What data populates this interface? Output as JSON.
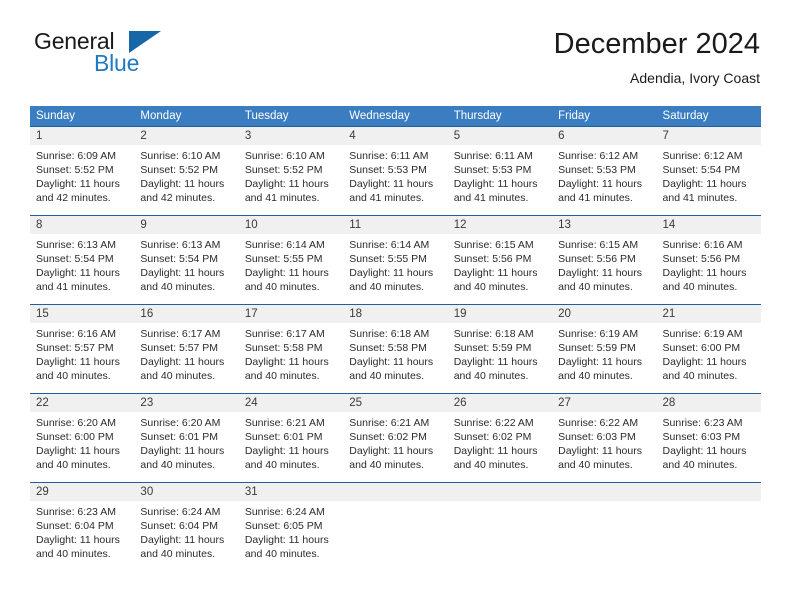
{
  "brand": {
    "name_part1": "General",
    "name_part2": "Blue",
    "triangle_color": "#1667a8",
    "blue_color": "#1f7ac0"
  },
  "header": {
    "title": "December 2024",
    "subtitle": "Adendia, Ivory Coast"
  },
  "theme": {
    "header_row_bg": "#3a7dc0",
    "week_divider": "#1f5fa0",
    "day_number_bg": "#f0f0f0",
    "text_color": "#2b2b2b"
  },
  "weekdays": [
    "Sunday",
    "Monday",
    "Tuesday",
    "Wednesday",
    "Thursday",
    "Friday",
    "Saturday"
  ],
  "weeks": [
    [
      {
        "day": "1",
        "sunrise": "Sunrise: 6:09 AM",
        "sunset": "Sunset: 5:52 PM",
        "daylight1": "Daylight: 11 hours",
        "daylight2": "and 42 minutes."
      },
      {
        "day": "2",
        "sunrise": "Sunrise: 6:10 AM",
        "sunset": "Sunset: 5:52 PM",
        "daylight1": "Daylight: 11 hours",
        "daylight2": "and 42 minutes."
      },
      {
        "day": "3",
        "sunrise": "Sunrise: 6:10 AM",
        "sunset": "Sunset: 5:52 PM",
        "daylight1": "Daylight: 11 hours",
        "daylight2": "and 41 minutes."
      },
      {
        "day": "4",
        "sunrise": "Sunrise: 6:11 AM",
        "sunset": "Sunset: 5:53 PM",
        "daylight1": "Daylight: 11 hours",
        "daylight2": "and 41 minutes."
      },
      {
        "day": "5",
        "sunrise": "Sunrise: 6:11 AM",
        "sunset": "Sunset: 5:53 PM",
        "daylight1": "Daylight: 11 hours",
        "daylight2": "and 41 minutes."
      },
      {
        "day": "6",
        "sunrise": "Sunrise: 6:12 AM",
        "sunset": "Sunset: 5:53 PM",
        "daylight1": "Daylight: 11 hours",
        "daylight2": "and 41 minutes."
      },
      {
        "day": "7",
        "sunrise": "Sunrise: 6:12 AM",
        "sunset": "Sunset: 5:54 PM",
        "daylight1": "Daylight: 11 hours",
        "daylight2": "and 41 minutes."
      }
    ],
    [
      {
        "day": "8",
        "sunrise": "Sunrise: 6:13 AM",
        "sunset": "Sunset: 5:54 PM",
        "daylight1": "Daylight: 11 hours",
        "daylight2": "and 41 minutes."
      },
      {
        "day": "9",
        "sunrise": "Sunrise: 6:13 AM",
        "sunset": "Sunset: 5:54 PM",
        "daylight1": "Daylight: 11 hours",
        "daylight2": "and 40 minutes."
      },
      {
        "day": "10",
        "sunrise": "Sunrise: 6:14 AM",
        "sunset": "Sunset: 5:55 PM",
        "daylight1": "Daylight: 11 hours",
        "daylight2": "and 40 minutes."
      },
      {
        "day": "11",
        "sunrise": "Sunrise: 6:14 AM",
        "sunset": "Sunset: 5:55 PM",
        "daylight1": "Daylight: 11 hours",
        "daylight2": "and 40 minutes."
      },
      {
        "day": "12",
        "sunrise": "Sunrise: 6:15 AM",
        "sunset": "Sunset: 5:56 PM",
        "daylight1": "Daylight: 11 hours",
        "daylight2": "and 40 minutes."
      },
      {
        "day": "13",
        "sunrise": "Sunrise: 6:15 AM",
        "sunset": "Sunset: 5:56 PM",
        "daylight1": "Daylight: 11 hours",
        "daylight2": "and 40 minutes."
      },
      {
        "day": "14",
        "sunrise": "Sunrise: 6:16 AM",
        "sunset": "Sunset: 5:56 PM",
        "daylight1": "Daylight: 11 hours",
        "daylight2": "and 40 minutes."
      }
    ],
    [
      {
        "day": "15",
        "sunrise": "Sunrise: 6:16 AM",
        "sunset": "Sunset: 5:57 PM",
        "daylight1": "Daylight: 11 hours",
        "daylight2": "and 40 minutes."
      },
      {
        "day": "16",
        "sunrise": "Sunrise: 6:17 AM",
        "sunset": "Sunset: 5:57 PM",
        "daylight1": "Daylight: 11 hours",
        "daylight2": "and 40 minutes."
      },
      {
        "day": "17",
        "sunrise": "Sunrise: 6:17 AM",
        "sunset": "Sunset: 5:58 PM",
        "daylight1": "Daylight: 11 hours",
        "daylight2": "and 40 minutes."
      },
      {
        "day": "18",
        "sunrise": "Sunrise: 6:18 AM",
        "sunset": "Sunset: 5:58 PM",
        "daylight1": "Daylight: 11 hours",
        "daylight2": "and 40 minutes."
      },
      {
        "day": "19",
        "sunrise": "Sunrise: 6:18 AM",
        "sunset": "Sunset: 5:59 PM",
        "daylight1": "Daylight: 11 hours",
        "daylight2": "and 40 minutes."
      },
      {
        "day": "20",
        "sunrise": "Sunrise: 6:19 AM",
        "sunset": "Sunset: 5:59 PM",
        "daylight1": "Daylight: 11 hours",
        "daylight2": "and 40 minutes."
      },
      {
        "day": "21",
        "sunrise": "Sunrise: 6:19 AM",
        "sunset": "Sunset: 6:00 PM",
        "daylight1": "Daylight: 11 hours",
        "daylight2": "and 40 minutes."
      }
    ],
    [
      {
        "day": "22",
        "sunrise": "Sunrise: 6:20 AM",
        "sunset": "Sunset: 6:00 PM",
        "daylight1": "Daylight: 11 hours",
        "daylight2": "and 40 minutes."
      },
      {
        "day": "23",
        "sunrise": "Sunrise: 6:20 AM",
        "sunset": "Sunset: 6:01 PM",
        "daylight1": "Daylight: 11 hours",
        "daylight2": "and 40 minutes."
      },
      {
        "day": "24",
        "sunrise": "Sunrise: 6:21 AM",
        "sunset": "Sunset: 6:01 PM",
        "daylight1": "Daylight: 11 hours",
        "daylight2": "and 40 minutes."
      },
      {
        "day": "25",
        "sunrise": "Sunrise: 6:21 AM",
        "sunset": "Sunset: 6:02 PM",
        "daylight1": "Daylight: 11 hours",
        "daylight2": "and 40 minutes."
      },
      {
        "day": "26",
        "sunrise": "Sunrise: 6:22 AM",
        "sunset": "Sunset: 6:02 PM",
        "daylight1": "Daylight: 11 hours",
        "daylight2": "and 40 minutes."
      },
      {
        "day": "27",
        "sunrise": "Sunrise: 6:22 AM",
        "sunset": "Sunset: 6:03 PM",
        "daylight1": "Daylight: 11 hours",
        "daylight2": "and 40 minutes."
      },
      {
        "day": "28",
        "sunrise": "Sunrise: 6:23 AM",
        "sunset": "Sunset: 6:03 PM",
        "daylight1": "Daylight: 11 hours",
        "daylight2": "and 40 minutes."
      }
    ],
    [
      {
        "day": "29",
        "sunrise": "Sunrise: 6:23 AM",
        "sunset": "Sunset: 6:04 PM",
        "daylight1": "Daylight: 11 hours",
        "daylight2": "and 40 minutes."
      },
      {
        "day": "30",
        "sunrise": "Sunrise: 6:24 AM",
        "sunset": "Sunset: 6:04 PM",
        "daylight1": "Daylight: 11 hours",
        "daylight2": "and 40 minutes."
      },
      {
        "day": "31",
        "sunrise": "Sunrise: 6:24 AM",
        "sunset": "Sunset: 6:05 PM",
        "daylight1": "Daylight: 11 hours",
        "daylight2": "and 40 minutes."
      },
      {
        "day": "",
        "sunrise": "",
        "sunset": "",
        "daylight1": "",
        "daylight2": ""
      },
      {
        "day": "",
        "sunrise": "",
        "sunset": "",
        "daylight1": "",
        "daylight2": ""
      },
      {
        "day": "",
        "sunrise": "",
        "sunset": "",
        "daylight1": "",
        "daylight2": ""
      },
      {
        "day": "",
        "sunrise": "",
        "sunset": "",
        "daylight1": "",
        "daylight2": ""
      }
    ]
  ]
}
